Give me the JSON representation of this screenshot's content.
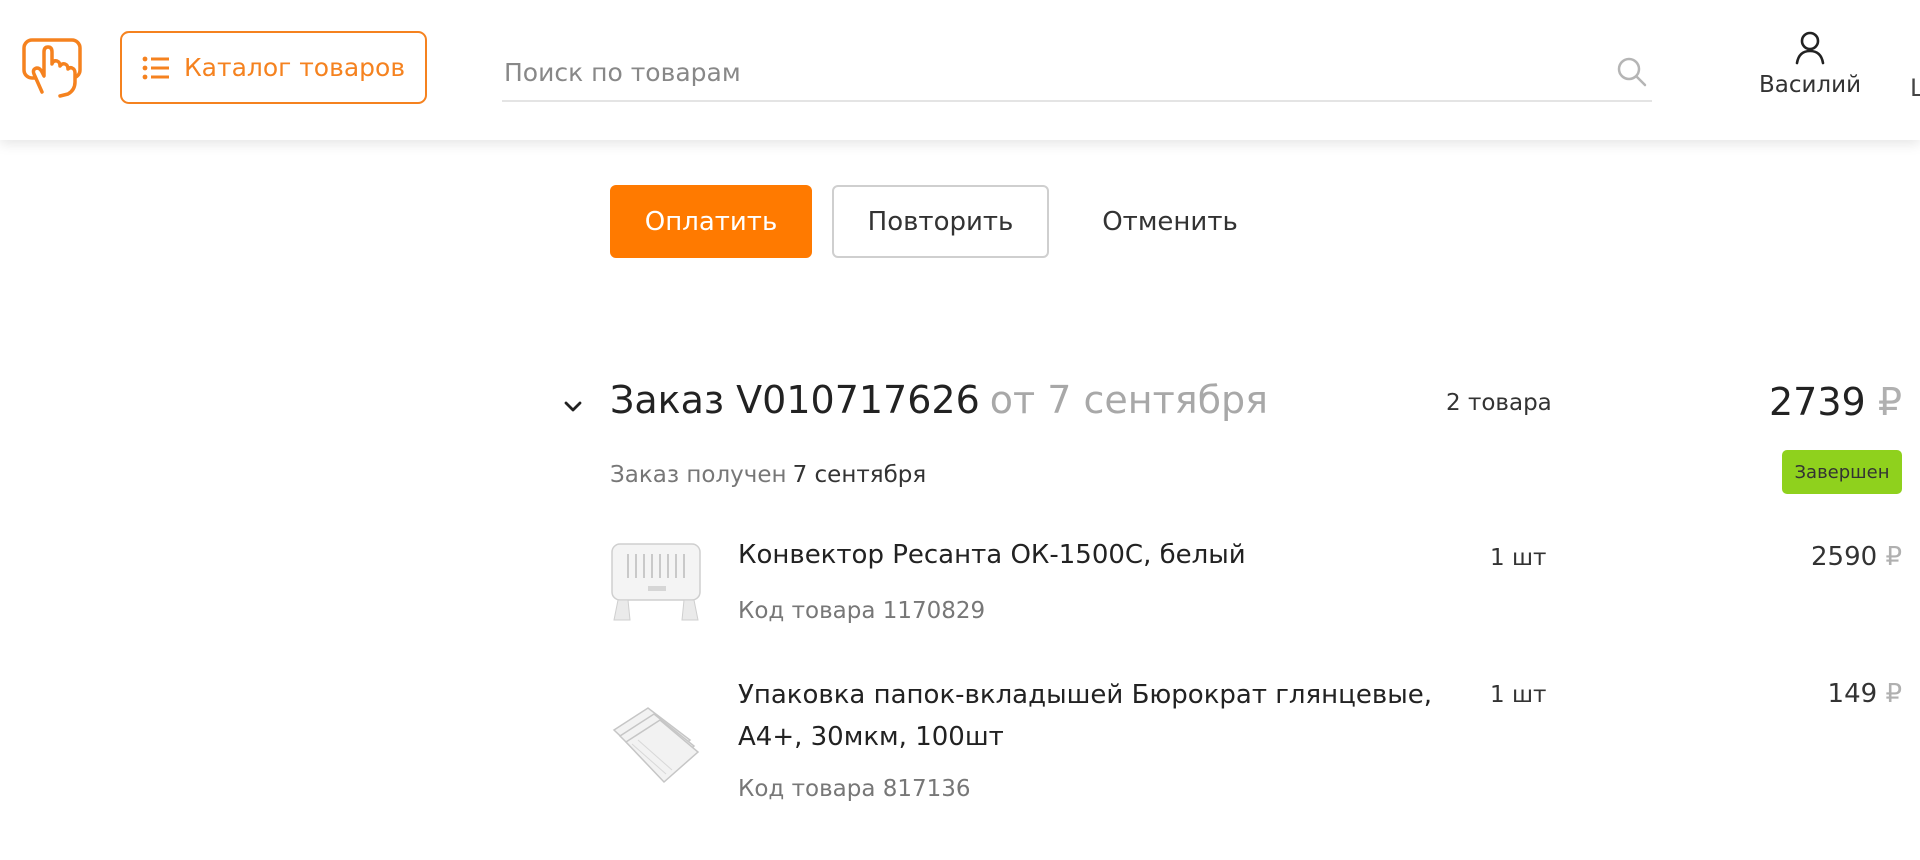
{
  "header": {
    "catalog_label": "Каталог товаров",
    "search_placeholder": "Поиск по товарам",
    "user_name": "Василий",
    "edge_glyph": "Ц"
  },
  "actions": {
    "pay_label": "Оплатить",
    "repeat_label": "Повторить",
    "cancel_label": "Отменить"
  },
  "order": {
    "title": "Заказ V010717626",
    "date": "от 7 сентября",
    "items_count": "2 товара",
    "total": "2739",
    "currency": "₽",
    "received_label": "Заказ получен",
    "received_date": "7 сентября",
    "status": "Завершен",
    "items": [
      {
        "name": "Конвектор Ресанта ОК-1500С, белый",
        "code": "Код товара 1170829",
        "qty": "1 шт",
        "price": "2590",
        "currency": "₽",
        "thumb_icon": "convector-heater-image"
      },
      {
        "name": "Упаковка папок-вкладышей Бюрократ глянцевые, А4+, 30мкм, 100шт",
        "code": "Код товара 817136",
        "qty": "1 шт",
        "price": "149",
        "currency": "₽",
        "thumb_icon": "file-sleeves-image"
      }
    ]
  },
  "colors": {
    "accent": "#ff7a00",
    "brand_outline": "#f5821f",
    "status_green": "#8fd11d",
    "muted_text": "#777777"
  },
  "icons": [
    "hand-pointer-logo-icon",
    "list-icon",
    "search-icon",
    "user-icon",
    "chevron-down-icon"
  ]
}
